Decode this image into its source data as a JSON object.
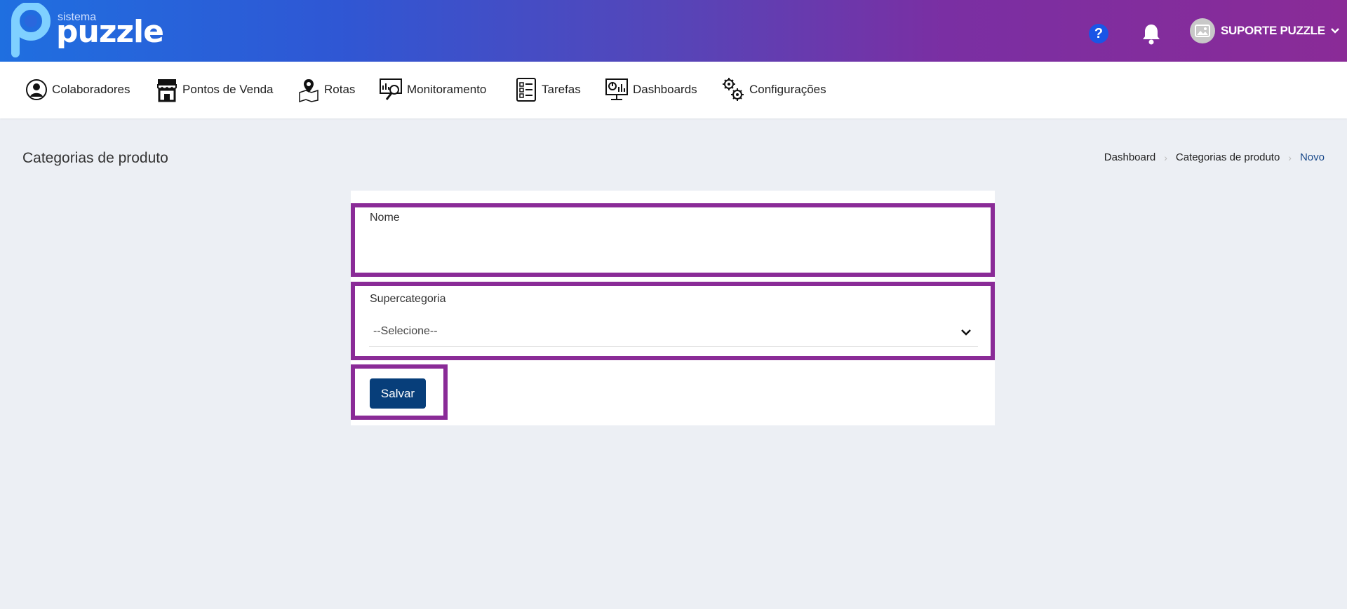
{
  "header": {
    "logo_small": "sistema",
    "logo_big": "puzzle",
    "help_icon": "question-circle-icon",
    "notifications_icon": "bell-icon",
    "user_name": "SUPORTE PUZZLE"
  },
  "nav": {
    "items": [
      {
        "label": "Colaboradores",
        "icon": "user-circle-icon"
      },
      {
        "label": "Pontos de Venda",
        "icon": "storefront-icon"
      },
      {
        "label": "Rotas",
        "icon": "map-pin-icon"
      },
      {
        "label": "Monitoramento",
        "icon": "monitor-search-icon"
      },
      {
        "label": "Tarefas",
        "icon": "checklist-icon"
      },
      {
        "label": "Dashboards",
        "icon": "dashboard-monitor-icon"
      },
      {
        "label": "Configurações",
        "icon": "gears-icon"
      }
    ]
  },
  "page": {
    "title": "Categorias de produto",
    "breadcrumb": [
      "Dashboard",
      "Categorias de produto",
      "Novo"
    ]
  },
  "form": {
    "name_label": "Nome",
    "name_value": "",
    "supercategory_label": "Supercategoria",
    "supercategory_value": "--Selecione--",
    "save_label": "Salvar"
  },
  "colors": {
    "highlight": "#8a2b97",
    "button": "#073e7a",
    "header_gradient_start": "#1f6fe0",
    "header_gradient_end": "#8a2b97"
  }
}
